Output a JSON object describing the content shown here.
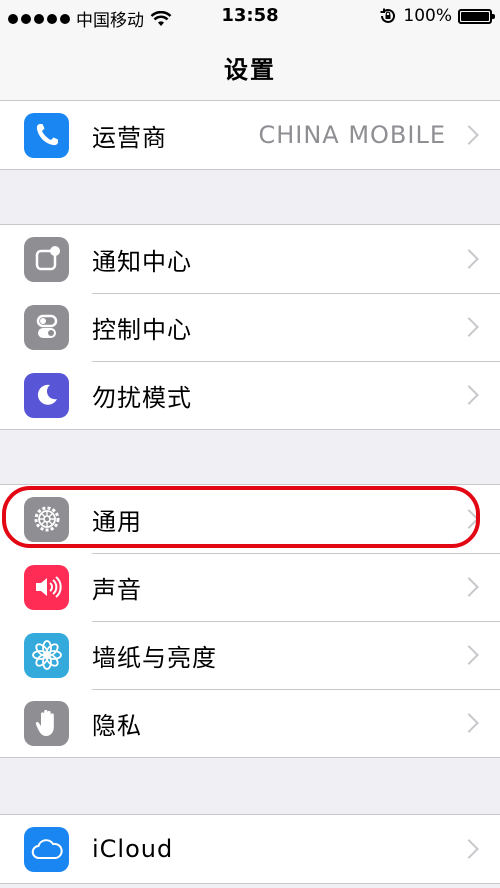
{
  "status_bar": {
    "carrier": "中国移动",
    "time": "13:58",
    "battery": "100%",
    "battery_level": 1.0
  },
  "nav": {
    "title": "设置"
  },
  "groups": [
    {
      "rows": [
        {
          "label": "运营商",
          "detail": "CHINA MOBILE",
          "icon": "phone-icon",
          "color": "#1a86f2"
        }
      ]
    },
    {
      "rows": [
        {
          "label": "通知中心",
          "icon": "notification-center-icon",
          "color": "#8e8e93"
        },
        {
          "label": "控制中心",
          "icon": "control-center-icon",
          "color": "#8e8e93"
        },
        {
          "label": "勿扰模式",
          "icon": "moon-icon",
          "color": "#5856d6"
        }
      ]
    },
    {
      "rows": [
        {
          "label": "通用",
          "icon": "gear-icon",
          "color": "#8e8e93"
        },
        {
          "label": "声音",
          "icon": "speaker-icon",
          "color": "#ff2d55"
        },
        {
          "label": "墙纸与亮度",
          "icon": "flower-icon",
          "color": "#34aadc"
        },
        {
          "label": "隐私",
          "icon": "hand-icon",
          "color": "#8e8e93"
        }
      ]
    },
    {
      "rows": [
        {
          "label": "iCloud",
          "icon": "cloud-icon",
          "color": "#1a86f2"
        }
      ]
    }
  ],
  "colors": {
    "highlight": "#e30613",
    "background": "#efeff4"
  }
}
